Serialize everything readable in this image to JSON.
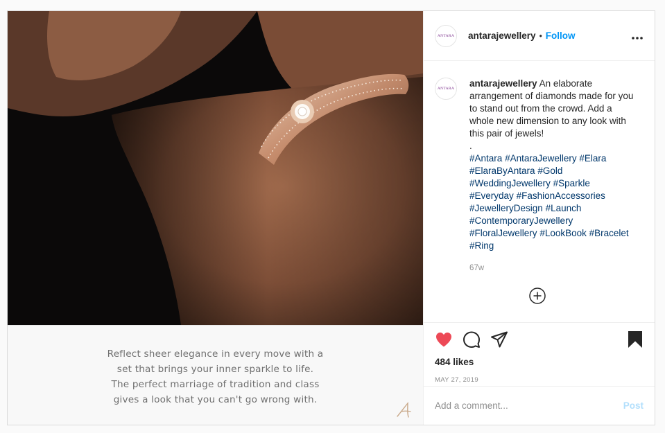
{
  "account": {
    "username": "antarajewellery",
    "avatar_text": "ANTARA",
    "follow_label": "Follow",
    "separator": "•"
  },
  "header": {
    "more_icon": "more-horizontal-icon"
  },
  "media": {
    "image": "Close-up of a forearm wearing a rose-gold diamond bracelet against a dark background",
    "text_lines": [
      "Reflect sheer elegance in every move with a",
      "set that brings your inner sparkle to life.",
      "The perfect marriage of tradition and class",
      "gives a look that you can't go wrong with."
    ]
  },
  "caption": {
    "username": "antarajewellery",
    "text": "An elaborate arrangement of diamonds made for you to stand out from the crowd. Add a whole new dimension to any look with this pair of jewels!",
    "dot_line": ".",
    "hashtags": [
      "#Antara",
      "#AntaraJewellery",
      "#Elara",
      "#ElaraByAntara",
      "#Gold",
      "#WeddingJewellery",
      "#Sparkle",
      "#Everyday",
      "#FashionAccessories",
      "#JewelleryDesign",
      "#Launch",
      "#ContemporaryJewellery",
      "#FloralJewellery",
      "#LookBook",
      "#Bracelet",
      "#Ring"
    ],
    "time": "67w"
  },
  "actions": {
    "like_icon": "heart-filled-icon",
    "comment_icon": "comment-icon",
    "share_icon": "share-icon",
    "save_icon": "bookmark-filled-icon",
    "likes": "484 likes",
    "date": "MAY 27, 2019"
  },
  "comment_box": {
    "placeholder": "Add a comment...",
    "post_label": "Post"
  },
  "colors": {
    "like": "#ed4956",
    "follow": "#0095f6",
    "hashtag": "#00376b",
    "post_disabled": "#b2dffc",
    "muted": "#8e8e8e"
  }
}
